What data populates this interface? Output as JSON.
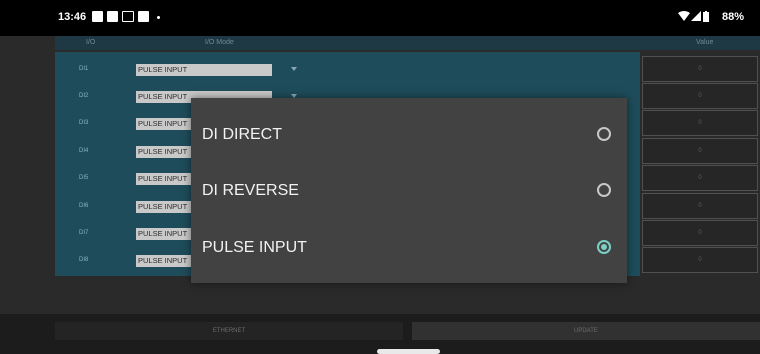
{
  "status_bar": {
    "time": "13:46",
    "battery": "88%",
    "icons": [
      "message-icon",
      "linkedin-icon",
      "mail-icon",
      "linkedin-icon",
      "notification-dot-icon",
      "wifi-icon",
      "signal-icon",
      "battery-icon"
    ]
  },
  "table": {
    "col_io": "I/O",
    "col_mode": "I/O Mode",
    "col_value": "Value",
    "rows": [
      {
        "io": "DI1",
        "mode": "PULSE INPUT",
        "value": "0"
      },
      {
        "io": "DI2",
        "mode": "PULSE INPUT",
        "value": "0"
      },
      {
        "io": "DI3",
        "mode": "PULSE INPUT",
        "value": "0"
      },
      {
        "io": "DI4",
        "mode": "PULSE INPUT",
        "value": "0"
      },
      {
        "io": "DI5",
        "mode": "PULSE INPUT",
        "value": "0"
      },
      {
        "io": "DI6",
        "mode": "PULSE INPUT",
        "value": "0"
      },
      {
        "io": "DI7",
        "mode": "PULSE INPUT",
        "value": "0"
      },
      {
        "io": "DI8",
        "mode": "PULSE INPUT",
        "value": "0"
      }
    ]
  },
  "bottom": {
    "ethernet_label": "ETHERNET",
    "update_label": "UPDATE"
  },
  "dialog": {
    "options": [
      {
        "label": "DI DIRECT",
        "selected": false
      },
      {
        "label": "DI REVERSE",
        "selected": false
      },
      {
        "label": "PULSE INPUT",
        "selected": true
      }
    ]
  },
  "colors": {
    "accent": "#7ad0c4",
    "table_bg": "#1e4c5b",
    "dialog_bg": "#424242"
  }
}
